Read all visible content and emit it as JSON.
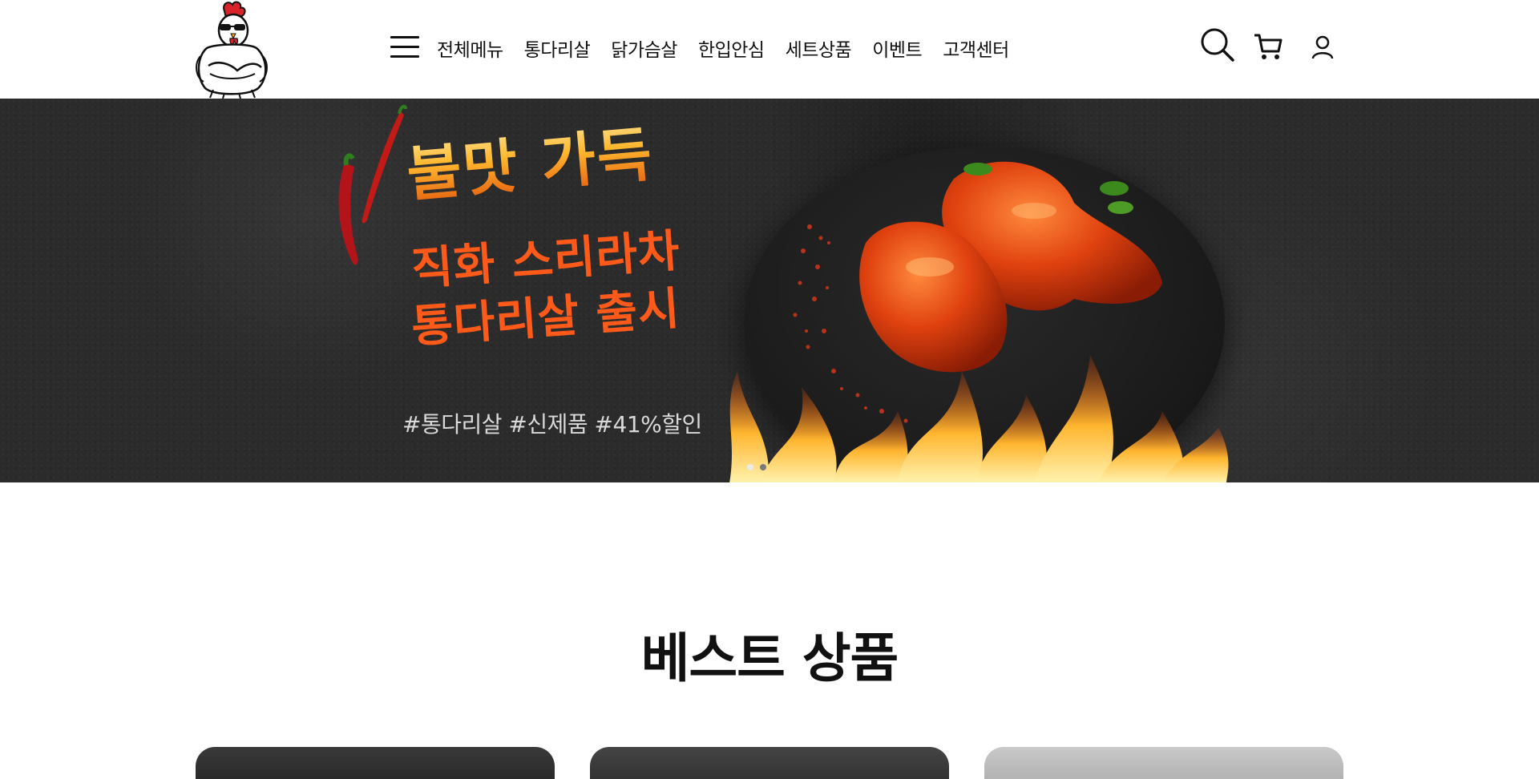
{
  "brand": {
    "logo_icon": "rooster-mascot-icon",
    "accent_red": "#d8232a"
  },
  "header": {
    "menu_icon": "hamburger-menu-icon",
    "nav": [
      {
        "label": "전체메뉴"
      },
      {
        "label": "통다리살"
      },
      {
        "label": "닭가슴살"
      },
      {
        "label": "한입안심"
      },
      {
        "label": "세트상품"
      },
      {
        "label": "이벤트"
      },
      {
        "label": "고객센터"
      }
    ],
    "icons": [
      "search-icon",
      "cart-icon",
      "user-icon"
    ]
  },
  "banner": {
    "headline": "불맛 가득",
    "subhead_line1": "직화 스리라차",
    "subhead_line2": "통다리살 출시",
    "tags": "#통다리살 #신제품 #41%할인",
    "slide_count": 2,
    "active_slide": 1,
    "colors": {
      "background": "#2b2b2b",
      "headline": "#ffb13a",
      "subhead": "#ff5a1a",
      "tags": "#d9d9d9"
    }
  },
  "best": {
    "title": "베스트 상품"
  }
}
